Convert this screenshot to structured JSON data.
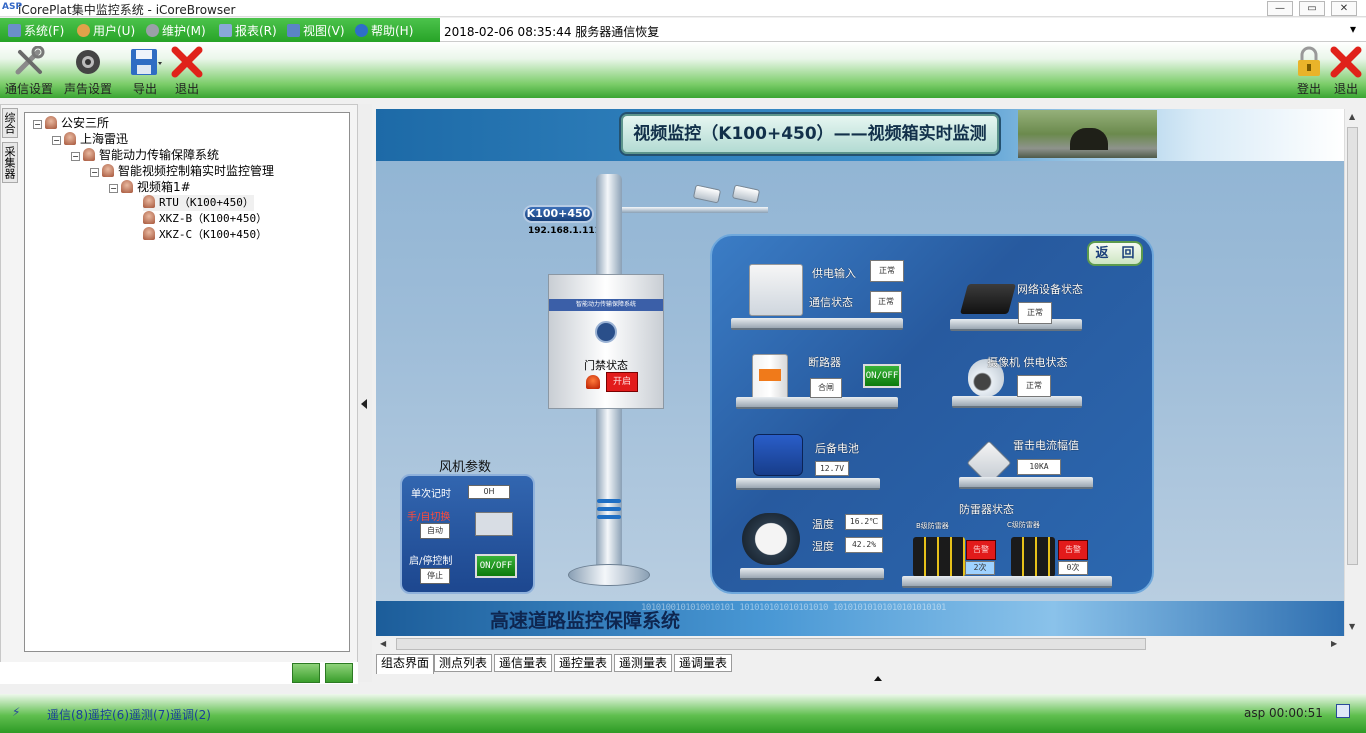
{
  "window": {
    "title": "iCorePlat集中监控系统 - iCoreBrowser",
    "app_icon": "ASP"
  },
  "menu": [
    {
      "label": "系统(F)",
      "color": "#6b8fc9"
    },
    {
      "label": "用户(U)",
      "color": "#e0a24a"
    },
    {
      "label": "维护(M)",
      "color": "#9aa0a8"
    },
    {
      "label": "报表(R)",
      "color": "#8aa8d8"
    },
    {
      "label": "视图(V)",
      "color": "#5b84c6"
    },
    {
      "label": "帮助(H)",
      "color": "#2e6fc8"
    }
  ],
  "status_message": "2018-02-06 08:35:44 服务器通信恢复",
  "toolbar": {
    "comm_settings": "通信设置",
    "sound_settings": "声告设置",
    "export": "导出",
    "quit": "退出",
    "logout": "登出",
    "exit": "退出"
  },
  "side_tabs": [
    "综合",
    "采集器"
  ],
  "tree": [
    {
      "label": "公安三所",
      "pm": "⊟"
    },
    {
      "label": "上海雷迅",
      "pm": "⊟"
    },
    {
      "label": "智能动力传输保障系统",
      "pm": "⊟"
    },
    {
      "label": "智能视频控制箱实时监控管理",
      "pm": "⊟"
    },
    {
      "label": "视频箱1#",
      "pm": "⊟"
    },
    {
      "label": "RTU（K100+450）"
    },
    {
      "label": "XKZ-B（K100+450）"
    },
    {
      "label": "XKZ-C（K100+450）"
    }
  ],
  "scada": {
    "title": "视频监控（K100+450）——视频箱实时监测",
    "station_badge": "K100+450",
    "ip": "192.168.1.111",
    "box_band": "智能动力传输保障系统",
    "door_label": "门禁状态",
    "door_value": "开启",
    "back": "返　回",
    "fan": {
      "title": "风机参数",
      "runtime_label": "单次记时",
      "runtime_value": "0H",
      "mode_label": "手/自切换",
      "mode_value": "自动",
      "control_label": "启/停控制",
      "control_value": "停止",
      "onoff": "ON/OFF"
    },
    "power_input_label": "供电输入",
    "power_input_value": "正常",
    "comm_label": "通信状态",
    "comm_value": "正常",
    "breaker_label": "断路器",
    "breaker_value": "合闸",
    "breaker_onoff": "ON/OFF",
    "battery_label": "后备电池",
    "battery_value": "12.7V",
    "temp_label": "温度",
    "temp_value": "16.2℃",
    "humidity_label": "湿度",
    "humidity_value": "42.2%",
    "net_label": "网络设备状态",
    "net_value": "正常",
    "cam_label": "摄像机 供电状态",
    "cam_value": "正常",
    "lightning_label": "雷击电流幅值",
    "lightning_value": "10KA",
    "spd_label": "防雷器状态",
    "spd_b_label": "B级防雷器",
    "spd_b_status": "告警",
    "spd_b_count": "2次",
    "spd_c_label": "C级防雷器",
    "spd_c_status": "告警",
    "spd_c_count": "0次",
    "footer_title": "高速道路监控保障系统",
    "footer_binary": "1010100101010010101 101010101010101010 10101010101010101010101"
  },
  "bottom_tabs": [
    "组态界面",
    "测点列表",
    "遥信量表",
    "遥控量表",
    "遥测量表",
    "遥调量表"
  ],
  "statusbar": {
    "counts": "遥信(8)遥控(6)遥测(7)遥调(2)",
    "session": "asp 00:00:51"
  }
}
